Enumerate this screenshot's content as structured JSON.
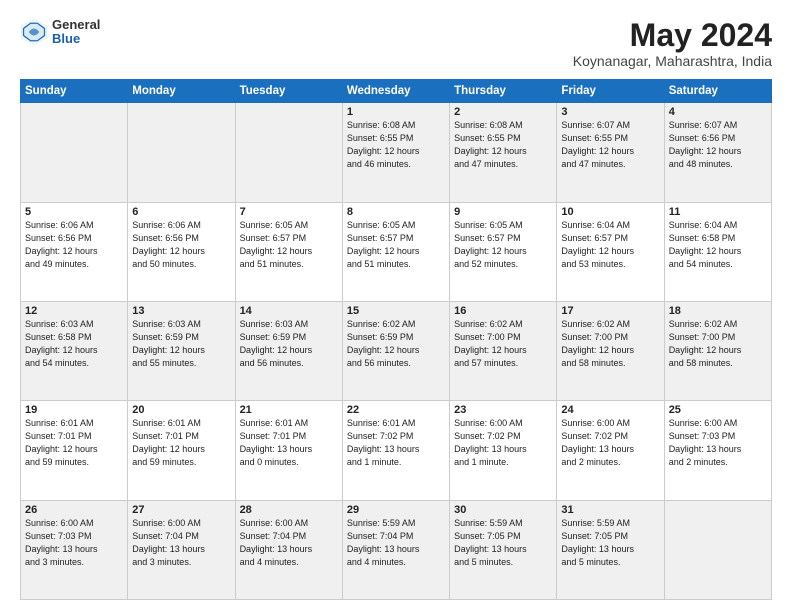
{
  "header": {
    "logo_general": "General",
    "logo_blue": "Blue",
    "title": "May 2024",
    "location": "Koynanagar, Maharashtra, India"
  },
  "days_of_week": [
    "Sunday",
    "Monday",
    "Tuesday",
    "Wednesday",
    "Thursday",
    "Friday",
    "Saturday"
  ],
  "weeks": [
    [
      {
        "day": "",
        "info": ""
      },
      {
        "day": "",
        "info": ""
      },
      {
        "day": "",
        "info": ""
      },
      {
        "day": "1",
        "info": "Sunrise: 6:08 AM\nSunset: 6:55 PM\nDaylight: 12 hours\nand 46 minutes."
      },
      {
        "day": "2",
        "info": "Sunrise: 6:08 AM\nSunset: 6:55 PM\nDaylight: 12 hours\nand 47 minutes."
      },
      {
        "day": "3",
        "info": "Sunrise: 6:07 AM\nSunset: 6:55 PM\nDaylight: 12 hours\nand 47 minutes."
      },
      {
        "day": "4",
        "info": "Sunrise: 6:07 AM\nSunset: 6:56 PM\nDaylight: 12 hours\nand 48 minutes."
      }
    ],
    [
      {
        "day": "5",
        "info": "Sunrise: 6:06 AM\nSunset: 6:56 PM\nDaylight: 12 hours\nand 49 minutes."
      },
      {
        "day": "6",
        "info": "Sunrise: 6:06 AM\nSunset: 6:56 PM\nDaylight: 12 hours\nand 50 minutes."
      },
      {
        "day": "7",
        "info": "Sunrise: 6:05 AM\nSunset: 6:57 PM\nDaylight: 12 hours\nand 51 minutes."
      },
      {
        "day": "8",
        "info": "Sunrise: 6:05 AM\nSunset: 6:57 PM\nDaylight: 12 hours\nand 51 minutes."
      },
      {
        "day": "9",
        "info": "Sunrise: 6:05 AM\nSunset: 6:57 PM\nDaylight: 12 hours\nand 52 minutes."
      },
      {
        "day": "10",
        "info": "Sunrise: 6:04 AM\nSunset: 6:57 PM\nDaylight: 12 hours\nand 53 minutes."
      },
      {
        "day": "11",
        "info": "Sunrise: 6:04 AM\nSunset: 6:58 PM\nDaylight: 12 hours\nand 54 minutes."
      }
    ],
    [
      {
        "day": "12",
        "info": "Sunrise: 6:03 AM\nSunset: 6:58 PM\nDaylight: 12 hours\nand 54 minutes."
      },
      {
        "day": "13",
        "info": "Sunrise: 6:03 AM\nSunset: 6:59 PM\nDaylight: 12 hours\nand 55 minutes."
      },
      {
        "day": "14",
        "info": "Sunrise: 6:03 AM\nSunset: 6:59 PM\nDaylight: 12 hours\nand 56 minutes."
      },
      {
        "day": "15",
        "info": "Sunrise: 6:02 AM\nSunset: 6:59 PM\nDaylight: 12 hours\nand 56 minutes."
      },
      {
        "day": "16",
        "info": "Sunrise: 6:02 AM\nSunset: 7:00 PM\nDaylight: 12 hours\nand 57 minutes."
      },
      {
        "day": "17",
        "info": "Sunrise: 6:02 AM\nSunset: 7:00 PM\nDaylight: 12 hours\nand 58 minutes."
      },
      {
        "day": "18",
        "info": "Sunrise: 6:02 AM\nSunset: 7:00 PM\nDaylight: 12 hours\nand 58 minutes."
      }
    ],
    [
      {
        "day": "19",
        "info": "Sunrise: 6:01 AM\nSunset: 7:01 PM\nDaylight: 12 hours\nand 59 minutes."
      },
      {
        "day": "20",
        "info": "Sunrise: 6:01 AM\nSunset: 7:01 PM\nDaylight: 12 hours\nand 59 minutes."
      },
      {
        "day": "21",
        "info": "Sunrise: 6:01 AM\nSunset: 7:01 PM\nDaylight: 13 hours\nand 0 minutes."
      },
      {
        "day": "22",
        "info": "Sunrise: 6:01 AM\nSunset: 7:02 PM\nDaylight: 13 hours\nand 1 minute."
      },
      {
        "day": "23",
        "info": "Sunrise: 6:00 AM\nSunset: 7:02 PM\nDaylight: 13 hours\nand 1 minute."
      },
      {
        "day": "24",
        "info": "Sunrise: 6:00 AM\nSunset: 7:02 PM\nDaylight: 13 hours\nand 2 minutes."
      },
      {
        "day": "25",
        "info": "Sunrise: 6:00 AM\nSunset: 7:03 PM\nDaylight: 13 hours\nand 2 minutes."
      }
    ],
    [
      {
        "day": "26",
        "info": "Sunrise: 6:00 AM\nSunset: 7:03 PM\nDaylight: 13 hours\nand 3 minutes."
      },
      {
        "day": "27",
        "info": "Sunrise: 6:00 AM\nSunset: 7:04 PM\nDaylight: 13 hours\nand 3 minutes."
      },
      {
        "day": "28",
        "info": "Sunrise: 6:00 AM\nSunset: 7:04 PM\nDaylight: 13 hours\nand 4 minutes."
      },
      {
        "day": "29",
        "info": "Sunrise: 5:59 AM\nSunset: 7:04 PM\nDaylight: 13 hours\nand 4 minutes."
      },
      {
        "day": "30",
        "info": "Sunrise: 5:59 AM\nSunset: 7:05 PM\nDaylight: 13 hours\nand 5 minutes."
      },
      {
        "day": "31",
        "info": "Sunrise: 5:59 AM\nSunset: 7:05 PM\nDaylight: 13 hours\nand 5 minutes."
      },
      {
        "day": "",
        "info": ""
      }
    ]
  ]
}
